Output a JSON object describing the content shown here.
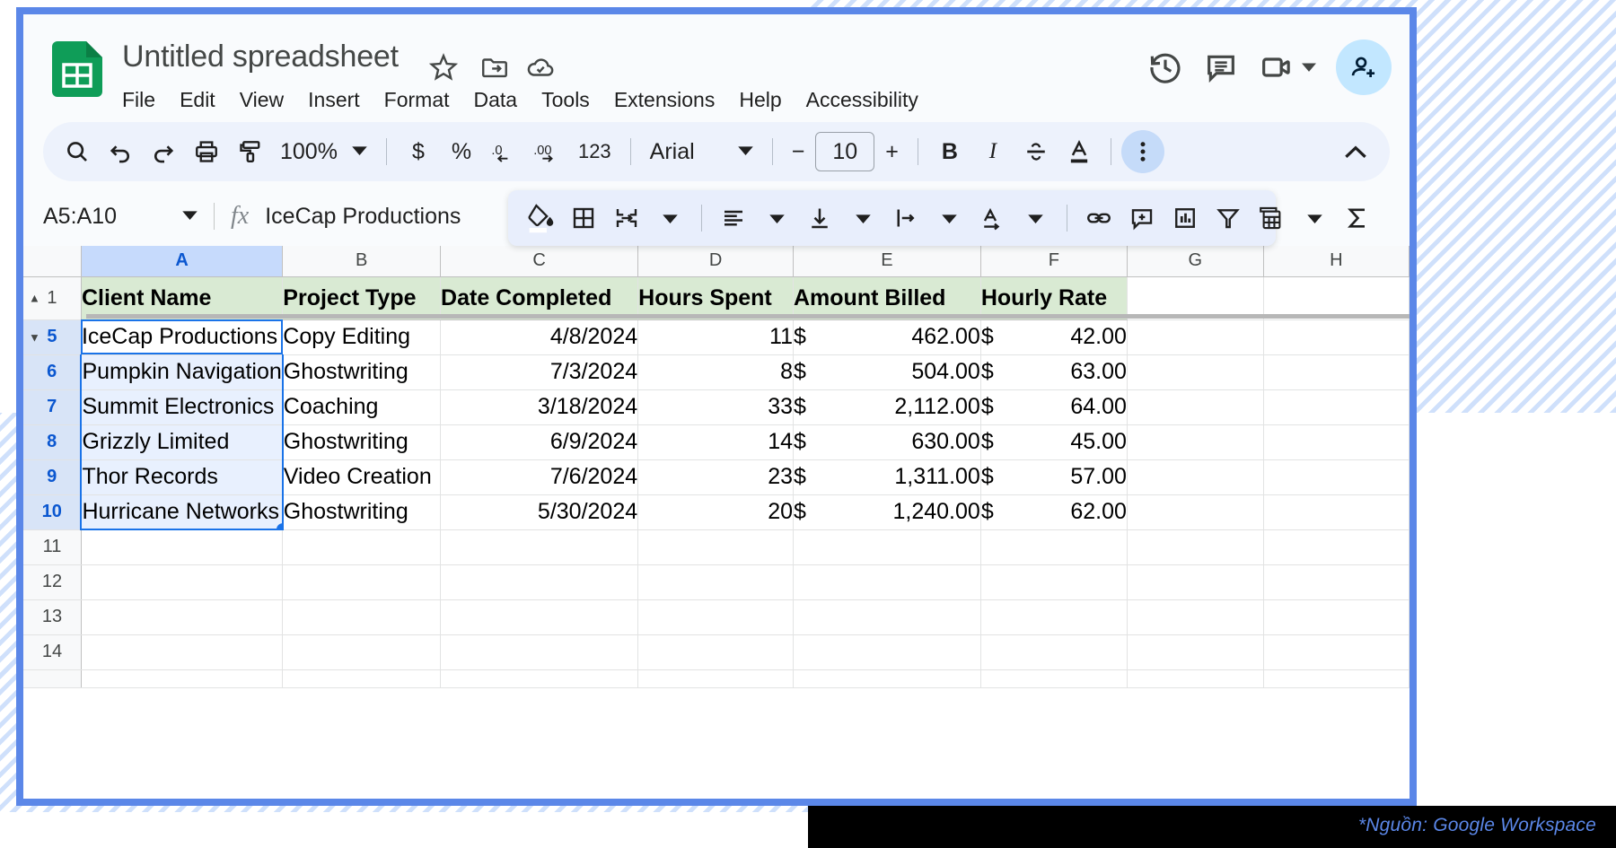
{
  "window": {
    "source_note": "*Nguồn: Google Workspace"
  },
  "header": {
    "doc_title": "Untitled spreadsheet",
    "logo_name": "google-sheets-logo",
    "title_icons": [
      "star-icon",
      "move-to-folder-icon",
      "cloud-saved-icon"
    ],
    "menus": [
      "File",
      "Edit",
      "View",
      "Insert",
      "Format",
      "Data",
      "Tools",
      "Extensions",
      "Help",
      "Accessibility"
    ],
    "right_icons": [
      "version-history-icon",
      "comment-icon",
      "video-call-icon",
      "chevron-down-icon"
    ],
    "share_button": "add-person-icon"
  },
  "toolbar": {
    "search": "search-icon",
    "undo": "undo-icon",
    "redo": "redo-icon",
    "print": "print-icon",
    "paint_format": "paint-format-icon",
    "zoom_value": "100%",
    "currency": "$",
    "percent": "%",
    "decrease_decimal": ".0",
    "increase_decimal": ".00",
    "number_format": "123",
    "font_name": "Arial",
    "font_decrease": "−",
    "font_size": "10",
    "font_increase": "+",
    "bold": "B",
    "italic": "I",
    "strikethrough": "S",
    "text_color": "A",
    "more_options": "more-vertical-icon",
    "collapse": "chevron-up-icon"
  },
  "overflow_toolbar": {
    "items": [
      "fill-color-icon",
      "borders-icon",
      "merge-cells-icon",
      "horizontal-align-icon",
      "vertical-align-icon",
      "text-wrapping-icon",
      "text-rotation-icon",
      "insert-link-icon",
      "insert-comment-icon",
      "insert-chart-icon",
      "filter-icon",
      "functions-menu-icon",
      "sum-icon"
    ]
  },
  "formula_bar": {
    "name_box": "A5:A10",
    "fx_label": "fx",
    "value": "IceCap Productions"
  },
  "grid": {
    "columns": [
      "A",
      "B",
      "C",
      "D",
      "E",
      "F",
      "G",
      "H"
    ],
    "selected_column": "A",
    "selection_range": "A5:A10",
    "row_numbers": [
      "1",
      "5",
      "6",
      "7",
      "8",
      "9",
      "10",
      "11",
      "12",
      "13",
      "14"
    ],
    "header_row_number": "1",
    "headers": [
      "Client Name",
      "Project Type",
      "Date Completed",
      "Hours Spent",
      "Amount Billed",
      "Hourly Rate",
      "",
      ""
    ],
    "rows": [
      {
        "num": "5",
        "client": "IceCap Productions",
        "project": "Copy Editing",
        "date": "4/8/2024",
        "hours": "11",
        "billed_symbol": "$",
        "billed": "462.00",
        "rate_symbol": "$",
        "rate": "42.00"
      },
      {
        "num": "6",
        "client": "Pumpkin Navigation",
        "project": "Ghostwriting",
        "date": "7/3/2024",
        "hours": "8",
        "billed_symbol": "$",
        "billed": "504.00",
        "rate_symbol": "$",
        "rate": "63.00"
      },
      {
        "num": "7",
        "client": "Summit Electronics",
        "project": "Coaching",
        "date": "3/18/2024",
        "hours": "33",
        "billed_symbol": "$",
        "billed": "2,112.00",
        "rate_symbol": "$",
        "rate": "64.00"
      },
      {
        "num": "8",
        "client": "Grizzly Limited",
        "project": "Ghostwriting",
        "date": "6/9/2024",
        "hours": "14",
        "billed_symbol": "$",
        "billed": "630.00",
        "rate_symbol": "$",
        "rate": "45.00"
      },
      {
        "num": "9",
        "client": "Thor Records",
        "project": "Video Creation",
        "date": "7/6/2024",
        "hours": "23",
        "billed_symbol": "$",
        "billed": "1,311.00",
        "rate_symbol": "$",
        "rate": "57.00"
      },
      {
        "num": "10",
        "client": "Hurricane Networks",
        "project": "Ghostwriting",
        "date": "5/30/2024",
        "hours": "20",
        "billed_symbol": "$",
        "billed": "1,240.00",
        "rate_symbol": "$",
        "rate": "62.00"
      }
    ],
    "empty_rows": [
      "11",
      "12",
      "13",
      "14"
    ]
  }
}
